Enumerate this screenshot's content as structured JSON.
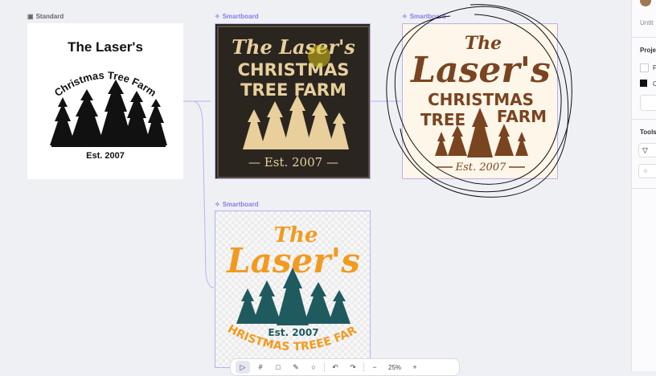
{
  "frames": {
    "standard": {
      "label": "Standard",
      "title": "The Laser's",
      "arc_text": "Christmas Tree Farm",
      "est": "Est. 2007"
    },
    "smart_dark": {
      "label": "Smartboard",
      "line1": "The Laser's",
      "line2": "CHRISTMAS",
      "line3": "TREE FARM",
      "est": "— Est. 2007 —"
    },
    "smart_cream": {
      "label": "Smartboard",
      "line1": "The",
      "line2": "Laser's",
      "line3": "CHRISTMAS",
      "line4": "TREE",
      "line5": "FARM",
      "est": "Est. 2007"
    },
    "smart_orange": {
      "label": "Smartboard",
      "line1": "The",
      "line2": "Laser's",
      "est": "Est. 2007",
      "arc_text": "CHRISTMAS TREEE FARM"
    }
  },
  "sidebar": {
    "title": "Untit",
    "project": "Proje",
    "item1": "F",
    "item2": "C",
    "tools": "Tools"
  },
  "toolbar": {
    "zoom": "25%"
  },
  "colors": {
    "dark_bg": "#2b2520",
    "tan": "#e8cf9c",
    "brown": "#7a4420",
    "orange": "#f29a1f",
    "teal": "#1f5a5f",
    "accent": "#8a7be8"
  }
}
